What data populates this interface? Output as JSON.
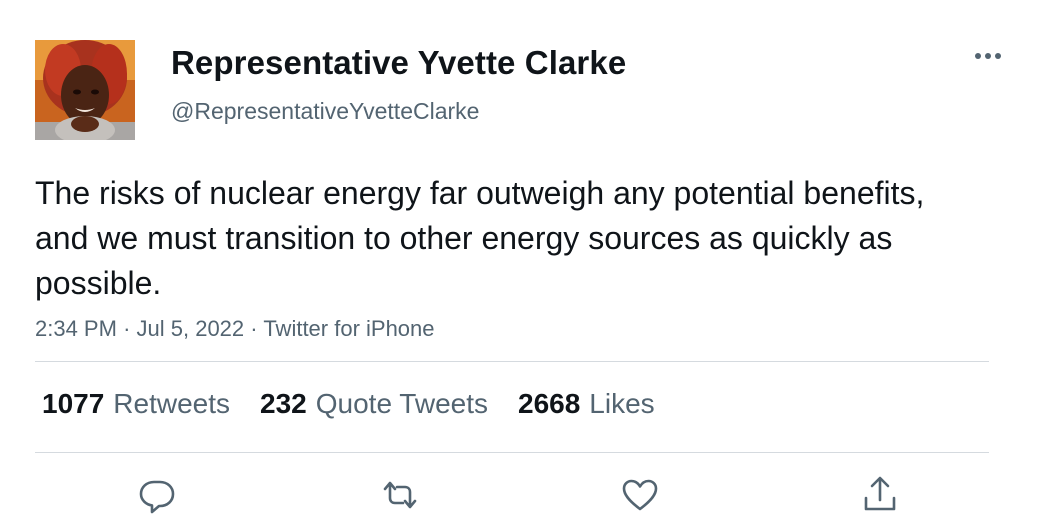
{
  "tweet": {
    "display_name": "Representative Yvette Clarke",
    "handle": "@RepresentativeYvetteClarke",
    "text": "The risks of nuclear energy far outweigh any potential benefits, and we must transition to other energy sources as quickly as possible.",
    "time": "2:34 PM",
    "separator": "·",
    "date": "Jul 5, 2022",
    "source": "Twitter for iPhone"
  },
  "stats": {
    "retweets_count": "1077",
    "retweets_label": "Retweets",
    "quotes_count": "232",
    "quotes_label": "Quote Tweets",
    "likes_count": "2668",
    "likes_label": "Likes"
  },
  "icons": {
    "more": "more-icon",
    "reply": "reply-icon",
    "retweet": "retweet-icon",
    "like": "heart-icon",
    "share": "share-icon"
  },
  "colors": {
    "text_primary": "#0f1419",
    "text_secondary": "#536471",
    "divider": "#d5dadf",
    "icon": "#536471"
  }
}
